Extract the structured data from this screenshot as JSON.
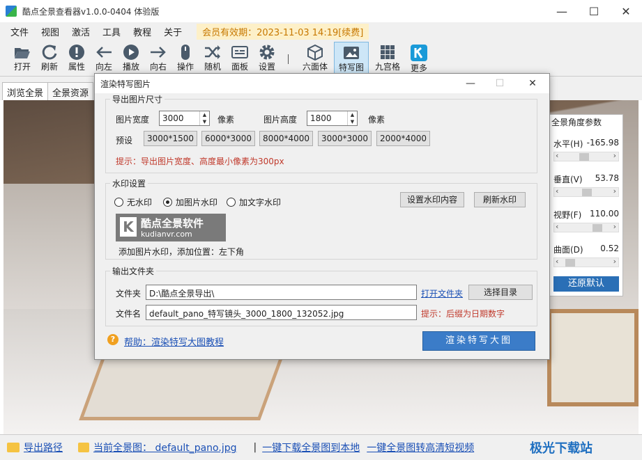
{
  "app": {
    "title": "酷点全景查看器v1.0.0-0404 体验版"
  },
  "menu": [
    "文件",
    "视图",
    "激活",
    "工具",
    "教程",
    "关于"
  ],
  "member": "会员有效期：2023-11-03 14:19[续费]",
  "toolbar": [
    {
      "label": "打开",
      "icon": "folder-open-icon"
    },
    {
      "label": "刷新",
      "icon": "refresh-icon"
    },
    {
      "label": "属性",
      "icon": "info-icon"
    },
    {
      "label": "向左",
      "icon": "arrow-left-icon"
    },
    {
      "label": "播放",
      "icon": "play-icon"
    },
    {
      "label": "向右",
      "icon": "arrow-right-icon"
    },
    {
      "label": "操作",
      "icon": "mouse-icon"
    },
    {
      "label": "随机",
      "icon": "shuffle-icon"
    },
    {
      "label": "面板",
      "icon": "panel-icon"
    },
    {
      "label": "设置",
      "icon": "gear-icon"
    },
    {
      "label": "六面体",
      "icon": "cube-icon"
    },
    {
      "label": "特写图",
      "icon": "image-icon"
    },
    {
      "label": "九宫格",
      "icon": "grid-icon"
    },
    {
      "label": "更多",
      "icon": "k-logo-icon"
    }
  ],
  "tabs": [
    "浏览全景",
    "全景资源"
  ],
  "side": {
    "title": "全景角度参数",
    "h_label": "水平(H)",
    "h_val": "-165.98",
    "v_label": "垂直(V)",
    "v_val": "53.78",
    "f_label": "视野(F)",
    "f_val": "110.00",
    "d_label": "曲面(D)",
    "d_val": "0.52",
    "reset": "还原默认"
  },
  "dialog": {
    "title": "渲染特写图片",
    "size_group": "导出图片尺寸",
    "width_label": "图片宽度",
    "width_val": "3000",
    "unit": "像素",
    "height_label": "图片高度",
    "height_val": "1800",
    "preset_label": "预设",
    "presets": [
      "3000*1500",
      "6000*3000",
      "8000*4000",
      "3000*3000",
      "2000*4000"
    ],
    "size_hint": "提示：导出图片宽度、高度最小像素为300px",
    "wm_group": "水印设置",
    "wm_none": "无水印",
    "wm_img": "加图片水印",
    "wm_txt": "加文字水印",
    "wm_set": "设置水印内容",
    "wm_refresh": "刷新水印",
    "wm_logo_text": "酷点全景软件",
    "wm_logo_url": "kudianvr.com",
    "wm_info": "添加图片水印，添加位置：左下角",
    "out_group": "输出文件夹",
    "folder_label": "文件夹",
    "folder_val": "D:\\酷点全景导出\\",
    "open_folder": "打开文件夹",
    "choose_dir": "选择目录",
    "name_label": "文件名",
    "name_val": "default_pano_特写镜头_3000_1800_132052.jpg",
    "name_hint": "提示：后缀为日期数字",
    "help": "帮助：渲染特写大图教程",
    "render": "渲染特写大图"
  },
  "status": {
    "export": "导出路径",
    "current": "当前全景图： default_pano.jpg",
    "sep": "|",
    "download": "一键下载全景图到本地",
    "convert": "一键全景图转高清短视频"
  },
  "brand": "极光下载站"
}
